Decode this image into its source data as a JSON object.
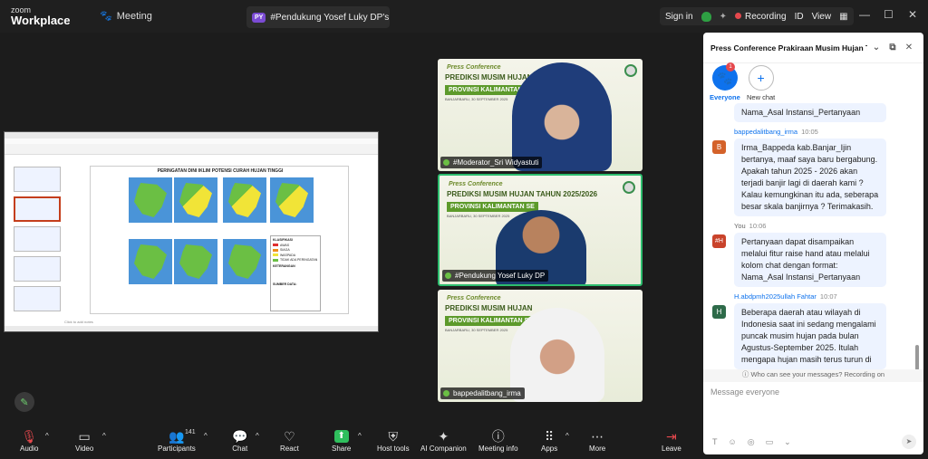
{
  "app": {
    "logo_line1": "zoom",
    "logo_line2": "Workplace",
    "meeting_label": "Meeting"
  },
  "share_tab": {
    "badge": "PY",
    "title": "#Pendukung Yosef Luky DP's scre"
  },
  "top_right": {
    "sign_in": "Sign in",
    "recording": "Recording",
    "id_label": "ID",
    "view": "View"
  },
  "slide": {
    "title": "PERINGATAN DINI IKLIM POTENSI CURAH HUJAN TINGGI",
    "legend_heading": "KLASIFIKASI",
    "legend_items": [
      {
        "label": "AWAS",
        "color": "#e03030"
      },
      {
        "label": "SIAGA",
        "color": "#f08c1c"
      },
      {
        "label": "WASPADA",
        "color": "#f1e437"
      },
      {
        "label": "TIDAK ADA PERINGATAN",
        "color": "#6bbf44"
      }
    ],
    "keterangan": "KETERANGAN",
    "sumber": "SUMBER DATA:",
    "click_notes": "Click to add notes"
  },
  "tiles": [
    {
      "press": "Press Conference",
      "prediksi": "PREDIKSI MUSIM HUJAN T",
      "prov": "PROVINSI KALIMANTAN",
      "date": "BANJARBARU, 30 SEPTEMBER 2025",
      "name": "#Moderator_Sri Widyastuti"
    },
    {
      "press": "Press Conference",
      "prediksi": "PREDIKSI MUSIM HUJAN TAHUN 2025/2026",
      "prov": "PROVINSI KALIMANTAN SE",
      "date": "BANJARBARU, 30 SEPTEMBER 2025",
      "name": "#Pendukung Yosef Luky DP"
    },
    {
      "press": "Press Conference",
      "prediksi": "PREDIKSI MUSIM HUJAN",
      "prov": "PROVINSI KALIMANTAN SEL",
      "date": "BANJARBARU, 30 SEPTEMBER 2025",
      "name": "bappedalitbang_irma"
    }
  ],
  "chat": {
    "title": "Press Conference Prakiraan Musim Hujan T...",
    "channels": [
      {
        "label": "Everyone",
        "badge": "1"
      },
      {
        "label": "New chat"
      }
    ],
    "messages": [
      {
        "sender": "",
        "time": "",
        "avatar": "",
        "avatar_color": "",
        "text": "Nama_Asal Instansi_Pertanyaan"
      },
      {
        "sender": "bappedalitbang_irma",
        "time": "10:05",
        "avatar": "B",
        "avatar_color": "#d4622a",
        "text": "Irma_Bappeda kab.Banjar_Ijin bertanya, maaf saya baru bergabung. Apakah tahun 2025 - 2026 akan terjadi banjir lagi di daerah kami ? Kalau kemungkinan itu ada, seberapa besar skala banjirnya ? Terimakasih."
      },
      {
        "sender": "You",
        "time": "10:06",
        "avatar": "#H",
        "avatar_color": "#c9432b",
        "text": "Pertanyaan dapat disampaikan melalui fitur raise hand atau melalui kolom chat dengan format: Nama_Asal Instansi_Pertanyaan"
      },
      {
        "sender": "H.abdpmh2025ullah Fahtar",
        "time": "10:07",
        "avatar": "H",
        "avatar_color": "#2e6b4a",
        "text": "Beberapa daerah atau wilayah di Indonesia saat ini sedang mengalami puncak musim hujan pada bulan Agustus-September 2025. Itulah mengapa hujan masih terus turun di"
      }
    ],
    "who_can_see": "Who can see your messages? Recording on",
    "input_placeholder": "Message everyone"
  },
  "toolbar": {
    "audio": "Audio",
    "video": "Video",
    "participants": "Participants",
    "participants_count": "141",
    "chat": "Chat",
    "react": "React",
    "share": "Share",
    "host_tools": "Host tools",
    "ai_companion": "AI Companion",
    "meeting_info": "Meeting info",
    "apps": "Apps",
    "more": "More",
    "leave": "Leave"
  }
}
